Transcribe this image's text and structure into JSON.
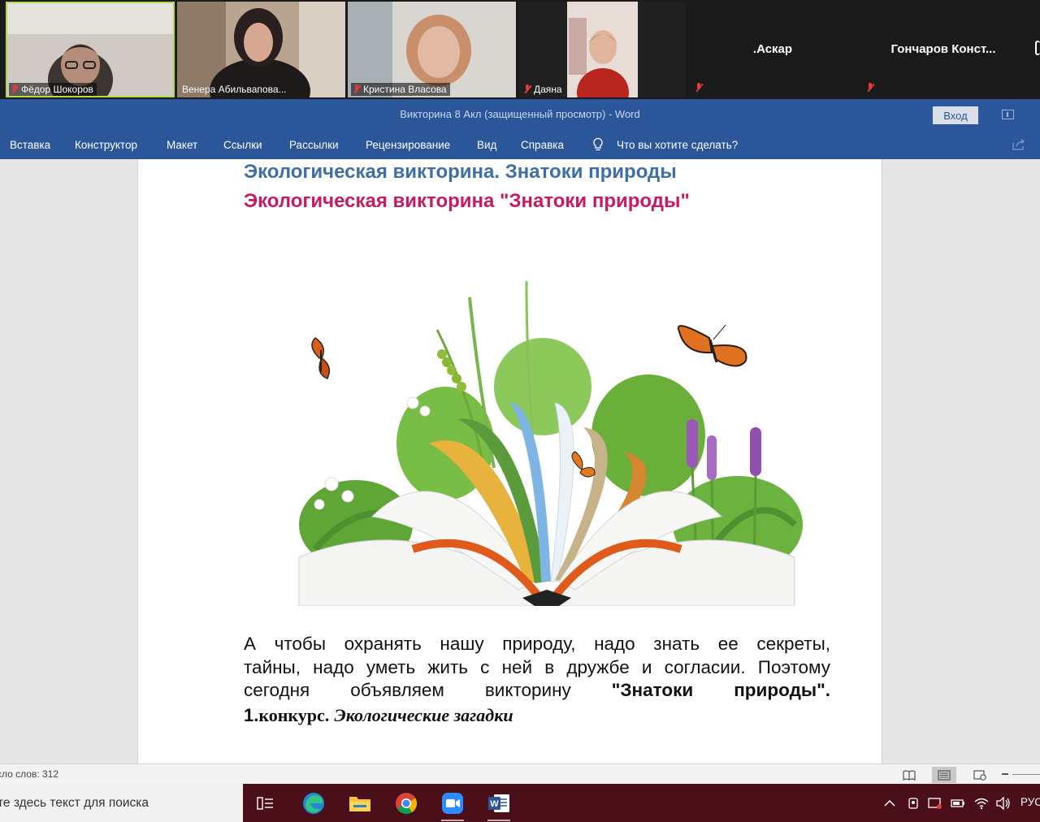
{
  "zoom": {
    "participants": [
      {
        "name": "Фёдор Шокоров",
        "muted": true,
        "video": true,
        "active_speaker": true
      },
      {
        "name": "Венера Абильвапова...",
        "muted": false,
        "video": true
      },
      {
        "name": "Кристина Власова",
        "muted": true,
        "video": true
      },
      {
        "name": "Даяна",
        "muted": true,
        "video": true
      },
      {
        "name": ".Аскар",
        "muted": true,
        "video": false
      },
      {
        "name": "Гончаров  Конст...",
        "muted": true,
        "video": false
      }
    ]
  },
  "word": {
    "title": "Викторина 8 Акл (защищенный просмотр)  -  Word",
    "signin_label": "Вход",
    "ribbon_tabs": [
      "Вставка",
      "Конструктор",
      "Макет",
      "Ссылки",
      "Рассылки",
      "Рецензирование",
      "Вид",
      "Справка"
    ],
    "tell_me": "Что вы хотите сделать?",
    "colors": {
      "ribbon": "#2b579a",
      "heading_blue": "#3e6fa6",
      "heading_pink": "#c71a63"
    }
  },
  "document": {
    "heading1": "Экологическая викторина. Знатоки природы",
    "heading2": "Экологическая викторина \"Знатоки природы\"",
    "paragraph_line1": "А чтобы охранять нашу природу, надо знать ее секреты,",
    "paragraph_line2": "тайны, надо уметь жить с ней в дружбе и согласии. Поэтому",
    "paragraph_line3_start": "сегодня объявляем викторину",
    "paragraph_line3_bold": "\"Знатоки природы\".",
    "contest_number": "1.",
    "contest_word": "конкурс.",
    "contest_title": "Экологические загадки"
  },
  "statusbar": {
    "word_count": "сло слов: 312"
  },
  "taskbar": {
    "search_placeholder": "те здесь текст для поиска",
    "language": "РУС",
    "apps": [
      "task-view",
      "edge",
      "file-explorer",
      "chrome",
      "zoom",
      "word"
    ]
  }
}
